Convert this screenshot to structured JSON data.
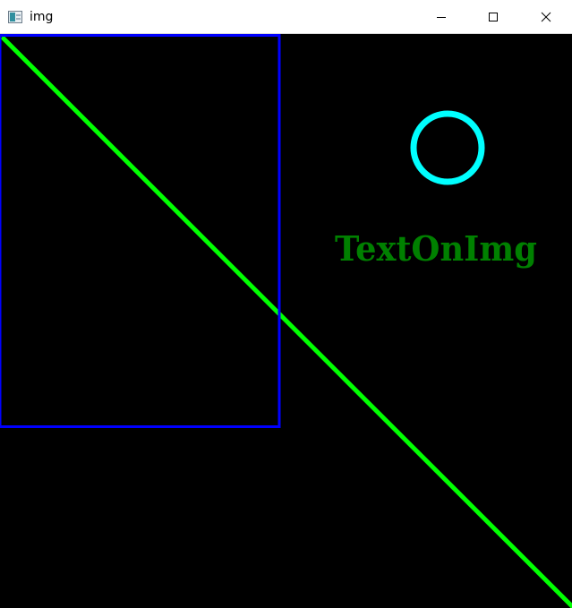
{
  "window": {
    "title": "img",
    "app_icon": "window-app-icon",
    "controls": {
      "minimize_icon": "minimize-icon",
      "maximize_icon": "maximize-icon",
      "close_icon": "close-icon"
    }
  },
  "canvas": {
    "background": "#000000",
    "rectangle": {
      "color": "#0000ff"
    },
    "line": {
      "color": "#00ff00"
    },
    "circle": {
      "color": "#00ffff"
    },
    "text": {
      "value": "TextOnImg",
      "color": "#008000"
    }
  }
}
